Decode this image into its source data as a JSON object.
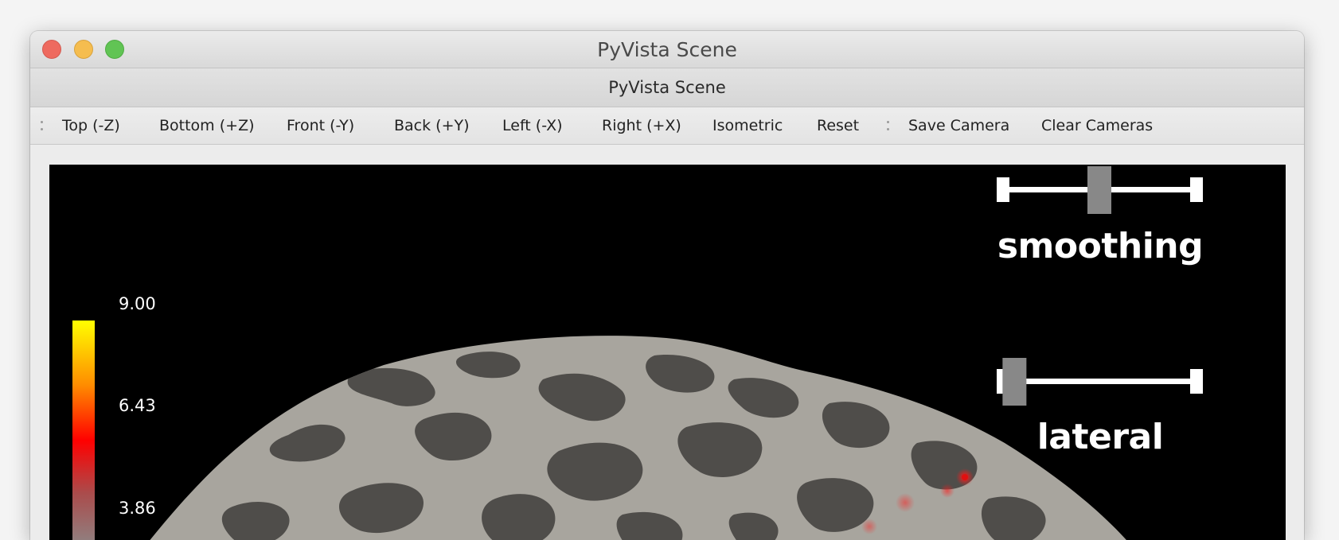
{
  "window": {
    "title": "PyVista Scene",
    "subtitle": "PyVista Scene"
  },
  "toolbar": {
    "buttons": [
      {
        "label": "Top (-Z)"
      },
      {
        "label": "Bottom (+Z)"
      },
      {
        "label": "Front (-Y)"
      },
      {
        "label": "Back (+Y)"
      },
      {
        "label": "Left (-X)"
      },
      {
        "label": "Right (+X)"
      },
      {
        "label": "Isometric"
      },
      {
        "label": "Reset"
      },
      {
        "label": "Save Camera"
      },
      {
        "label": "Clear Cameras"
      }
    ]
  },
  "scene": {
    "colorbar": {
      "ticks": [
        "9.00",
        "6.43",
        "3.86"
      ],
      "colors": [
        "#ffff00",
        "#ff8c00",
        "#ff0000",
        "#aa4c4c",
        "#8c8888"
      ]
    },
    "sliders": [
      {
        "label": "smoothing",
        "value": 0.5
      },
      {
        "label": "lateral",
        "value": 0.07
      }
    ],
    "surface_colors": {
      "light": "#a8a59e",
      "dark": "#4f4d4a",
      "activation": "#e01010"
    }
  }
}
